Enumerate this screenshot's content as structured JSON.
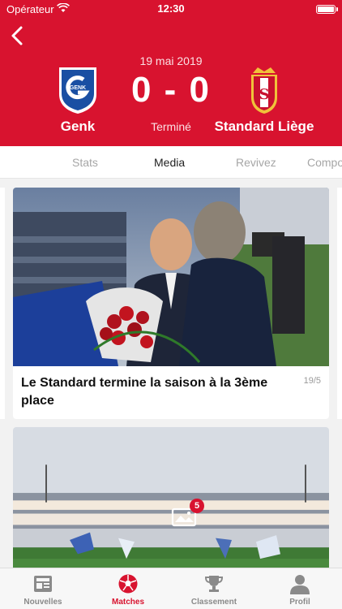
{
  "statusbar": {
    "carrier": "Opérateur",
    "time": "12:30"
  },
  "match": {
    "date": "19 mai 2019",
    "score": "0 - 0",
    "status": "Terminé",
    "home": {
      "name": "Genk",
      "logo_text": "GENK"
    },
    "away": {
      "name": "Standard Liège"
    }
  },
  "tabs": [
    "Stats",
    "Media",
    "Revivez",
    "Compo"
  ],
  "active_tab": "Media",
  "cards": [
    {
      "title": "Le Standard termine la saison à la 3ème place",
      "date": "19/5"
    },
    {
      "title": "",
      "date": "",
      "gallery_count": "5"
    }
  ],
  "tabbar": [
    {
      "label": "Nouvelles",
      "icon": "news-icon"
    },
    {
      "label": "Matches",
      "icon": "soccer-ball-icon",
      "active": true
    },
    {
      "label": "Classement",
      "icon": "trophy-icon"
    },
    {
      "label": "Profil",
      "icon": "user-icon"
    }
  ],
  "colors": {
    "brand_red": "#d8132f",
    "genk_blue": "#1a4fa3",
    "inactive_gray": "#8a8a8a"
  }
}
